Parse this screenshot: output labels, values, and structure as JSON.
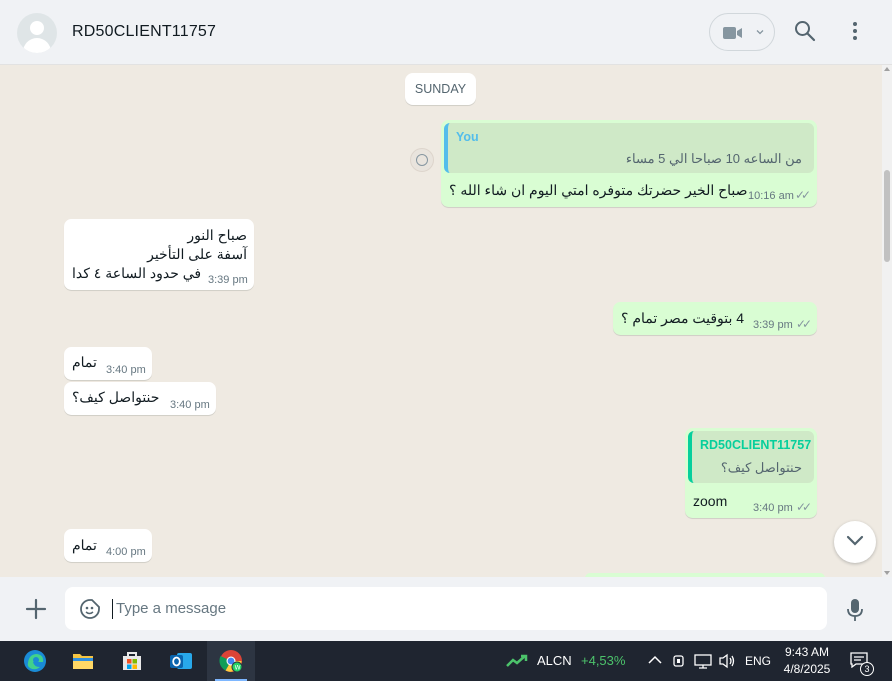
{
  "header": {
    "contact_name": "RD50CLIENT11757"
  },
  "chat": {
    "day_separator": "SUNDAY",
    "messages": [
      {
        "direction": "out",
        "quote_author": "You",
        "quote_text": "من الساعه 10 صباحا الي 5 مساء",
        "text": "صباح الخير حضرتك متوفره امتي اليوم ان شاء الله ؟",
        "time": "10:16 am"
      },
      {
        "direction": "in",
        "lines": [
          "صباح النور",
          "آسفة على التأخير",
          "في حدود الساعة ٤ كدا"
        ],
        "time": "3:39 pm"
      },
      {
        "direction": "out",
        "text": "4 بتوقيت مصر تمام ؟",
        "time": "3:39 pm"
      },
      {
        "direction": "in",
        "text": "تمام",
        "time": "3:40 pm"
      },
      {
        "direction": "in",
        "text": "حنتواصل كيف؟",
        "time": "3:40 pm"
      },
      {
        "direction": "out",
        "quote_author": "RD50CLIENT11757",
        "quote_text": "حنتواصل كيف؟",
        "text": "zoom",
        "time": "3:40 pm"
      },
      {
        "direction": "in",
        "text": "تمام",
        "time": "4:00 pm"
      }
    ]
  },
  "composer": {
    "placeholder": "Type a message"
  },
  "taskbar": {
    "stock_symbol": "ALCN",
    "stock_change": "+4,53%",
    "language": "ENG",
    "time": "9:43 AM",
    "date": "4/8/2025",
    "notifications_count": "3"
  },
  "colors": {
    "outgoing_bubble": "#d9fdd3",
    "incoming_bubble": "#ffffff",
    "quote_you_accent": "#53bdeb",
    "quote_contact_accent": "#06cf9c",
    "stock_up": "#4cc36b"
  }
}
